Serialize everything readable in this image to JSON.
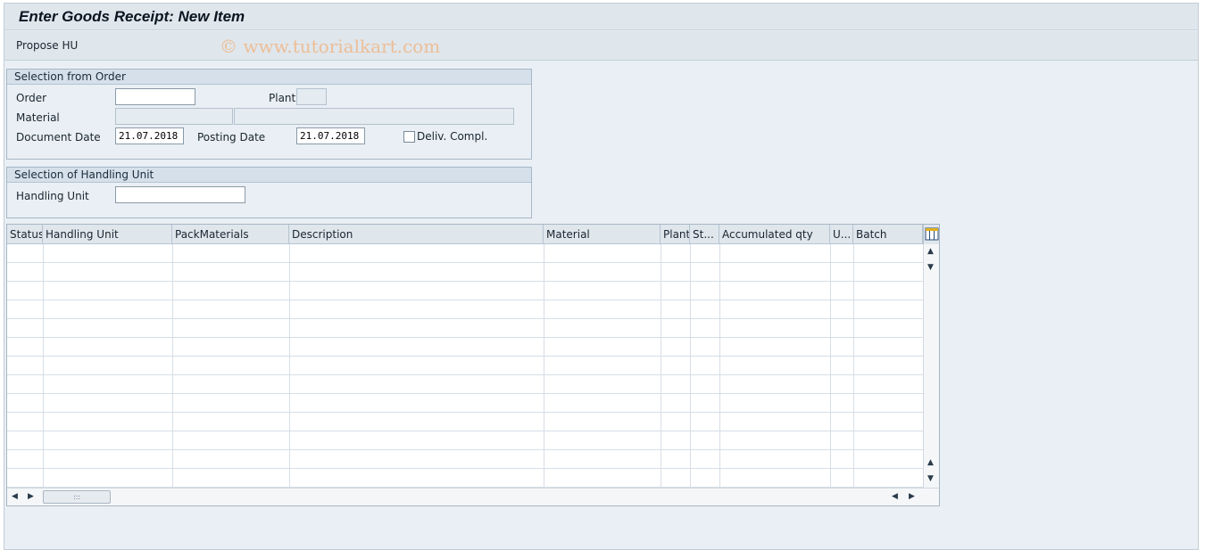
{
  "window": {
    "title": "Enter Goods Receipt: New Item",
    "watermark": "© www.tutorialkart.com"
  },
  "toolbar": {
    "propose_hu_label": "Propose HU"
  },
  "selection_from_order": {
    "header": "Selection from Order",
    "order_label": "Order",
    "order_value": "",
    "plant_label": "Plant",
    "plant_value": "",
    "material_label": "Material",
    "material_value": "",
    "material_description": "",
    "document_date_label": "Document Date",
    "document_date_value": "21.07.2018",
    "posting_date_label": "Posting Date",
    "posting_date_value": "21.07.2018",
    "deliv_compl_label": "Deliv. Compl.",
    "deliv_compl_checked": false
  },
  "selection_of_handling_unit": {
    "header": "Selection of Handling Unit",
    "handling_unit_label": "Handling Unit",
    "handling_unit_value": ""
  },
  "table": {
    "columns": [
      "Status",
      "Handling Unit",
      "PackMaterials",
      "Description",
      "Material",
      "Plant",
      "St...",
      "Accumulated qty",
      "U...",
      "Batch"
    ],
    "rows": [],
    "column_config_icon": "table-settings-icon",
    "scroll_up_icon": "triangle-up-icon",
    "scroll_down_icon": "triangle-down-icon",
    "scroll_left_icon": "triangle-left-icon",
    "scroll_right_icon": "triangle-right-icon"
  }
}
